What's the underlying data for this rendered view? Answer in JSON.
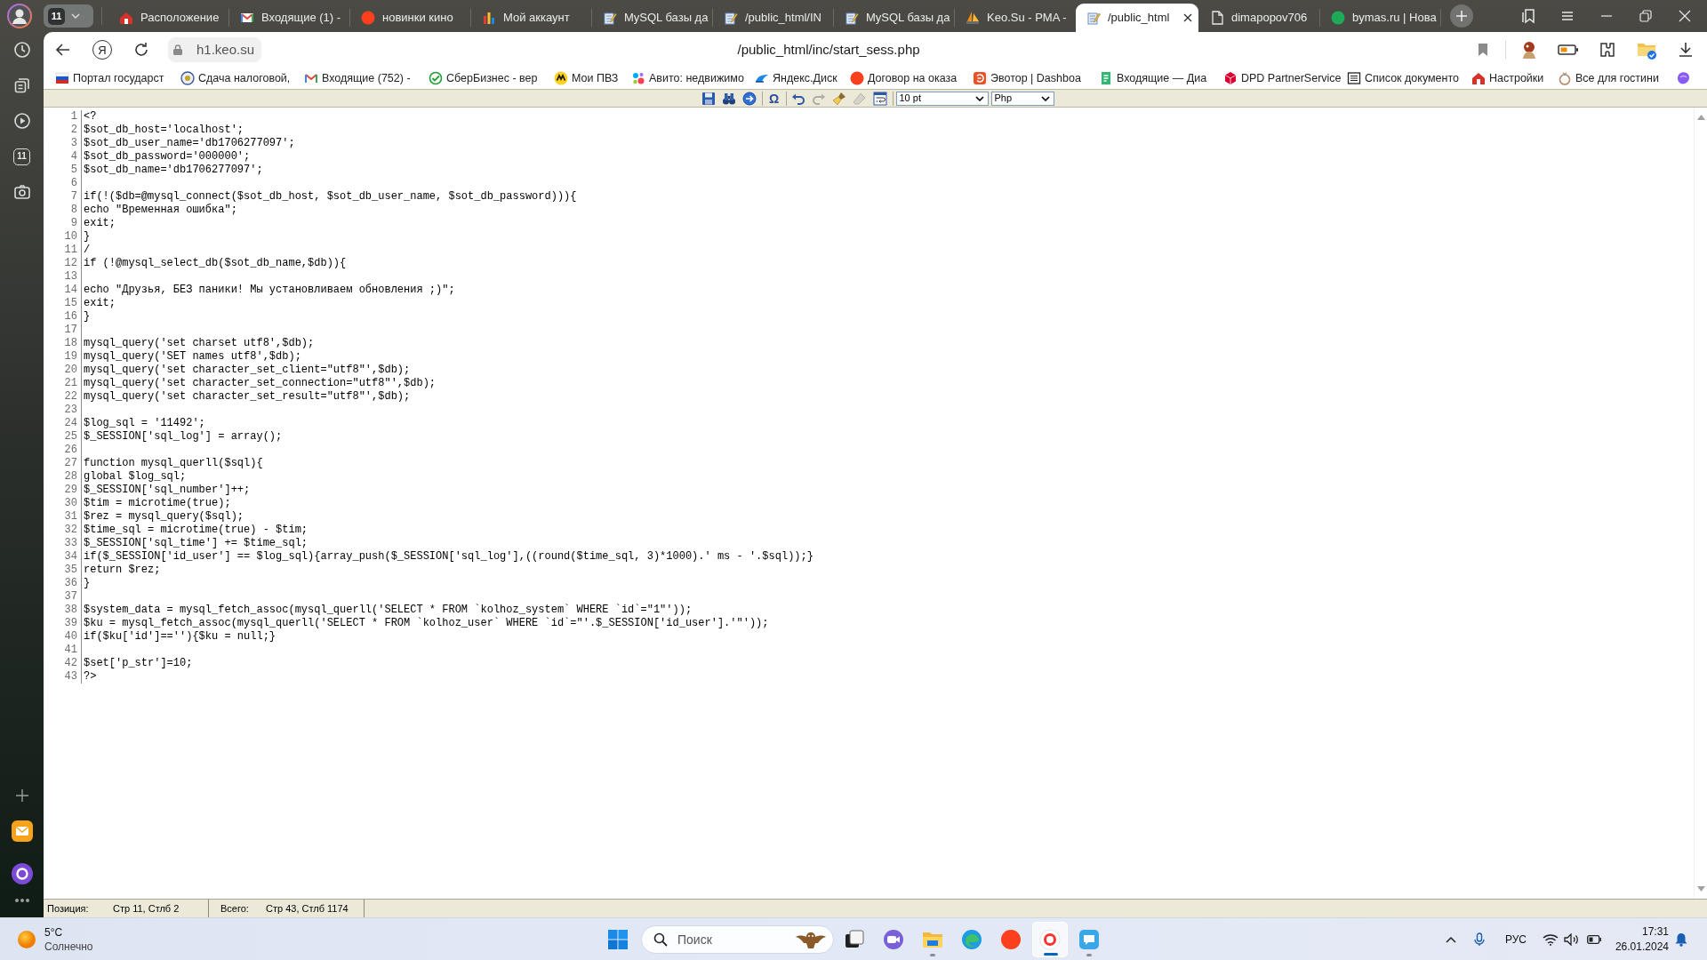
{
  "browser": {
    "tab_count": "11",
    "tabs": [
      {
        "title": "Расположение",
        "selected": false
      },
      {
        "title": "Входящие (1) -",
        "selected": false
      },
      {
        "title": "новинки кино",
        "selected": false
      },
      {
        "title": "Мой аккаунт",
        "selected": false
      },
      {
        "title": "MySQL базы да",
        "selected": false
      },
      {
        "title": "/public_html/IN",
        "selected": false
      },
      {
        "title": "MySQL базы да",
        "selected": false
      },
      {
        "title": "Keo.Su - PMA -",
        "selected": false
      },
      {
        "title": "/public_html",
        "selected": true
      },
      {
        "title": "dimapopov706",
        "selected": false
      },
      {
        "title": "bymas.ru | Нова",
        "selected": false
      }
    ],
    "home_label": "Я",
    "address": "h1.keo.su",
    "page_title": "/public_html/inc/start_sess.php",
    "bookmarks": [
      "Портал государст",
      "Сдача налоговой,",
      "Входящие (752) -",
      "СберБизнес - вер",
      "Мои ПВЗ",
      "Авито: недвижимо",
      "Яндекс.Диск",
      "Договор на оказа",
      "Эвотор | Dashboa",
      "Входящие — Диа",
      "DPD PartnerService",
      "Список документо",
      "Настройки",
      "Все для гостини"
    ]
  },
  "sidebar": {
    "tab_count": "11"
  },
  "editor": {
    "toolbar": {
      "buttons": [
        {
          "disabled": false
        },
        {
          "disabled": false
        },
        {
          "disabled": false
        },
        {
          "label": "Ω",
          "disabled": false
        },
        {
          "disabled": false
        },
        {
          "disabled": true
        },
        {
          "disabled": false
        },
        {
          "disabled": true
        },
        {
          "disabled": false
        }
      ],
      "font_size": "10 pt",
      "language": "Php"
    },
    "lines": [
      {
        "number": "1",
        "text": "<?"
      },
      {
        "number": "2",
        "text": "$sot_db_host='localhost';"
      },
      {
        "number": "3",
        "text": "$sot_db_user_name='db1706277097';"
      },
      {
        "number": "4",
        "text": "$sot_db_password='000000';"
      },
      {
        "number": "5",
        "text": "$sot_db_name='db1706277097';"
      },
      {
        "number": "6"
      },
      {
        "number": "7",
        "text": "if(!($db=@mysql_connect($sot_db_host, $sot_db_user_name, $sot_db_password))){"
      },
      {
        "number": "8",
        "text": "echo \"Временная ошибка\";"
      },
      {
        "number": "9",
        "text": "exit;"
      },
      {
        "number": "10",
        "text": "}"
      },
      {
        "number": "11",
        "text": "/"
      },
      {
        "number": "12",
        "text": "if (!@mysql_select_db($sot_db_name,$db)){"
      },
      {
        "number": "13"
      },
      {
        "number": "14",
        "text": "echo \"Друзья, БЕЗ паники! Мы установливаем обновления ;)\";"
      },
      {
        "number": "15",
        "text": "exit;"
      },
      {
        "number": "16",
        "text": "}"
      },
      {
        "number": "17"
      },
      {
        "number": "18",
        "text": "mysql_query('set charset utf8',$db);"
      },
      {
        "number": "19",
        "text": "mysql_query('SET names utf8',$db);"
      },
      {
        "number": "20",
        "text": "mysql_query('set character_set_client=\"utf8\"',$db);"
      },
      {
        "number": "21",
        "text": "mysql_query('set character_set_connection=\"utf8\"',$db);"
      },
      {
        "number": "22",
        "text": "mysql_query('set character_set_result=\"utf8\"',$db);"
      },
      {
        "number": "23"
      },
      {
        "number": "24",
        "text": "$log_sql = '11492';"
      },
      {
        "number": "25",
        "text": "$_SESSION['sql_log'] = array();"
      },
      {
        "number": "26"
      },
      {
        "number": "27",
        "text": "function mysql_querll($sql){"
      },
      {
        "number": "28",
        "text": "global $log_sql;"
      },
      {
        "number": "29",
        "text": "$_SESSION['sql_number']++;"
      },
      {
        "number": "30",
        "text": "$tim = microtime(true);"
      },
      {
        "number": "31",
        "text": "$rez = mysql_query($sql);"
      },
      {
        "number": "32",
        "text": "$time_sql = microtime(true) - $tim;"
      },
      {
        "number": "33",
        "text": "$_SESSION['sql_time'] += $time_sql;"
      },
      {
        "number": "34",
        "text": "if($_SESSION['id_user'] == $log_sql){array_push($_SESSION['sql_log'],((round($time_sql, 3)*1000).' ms - '.$sql));}"
      },
      {
        "number": "35",
        "text": "return $rez;"
      },
      {
        "number": "36",
        "text": "}"
      },
      {
        "number": "37"
      },
      {
        "number": "38",
        "text": "$system_data = mysql_fetch_assoc(mysql_querll('SELECT * FROM `kolhoz_system` WHERE `id`=\"1\"'));"
      },
      {
        "number": "39",
        "text": "$ku = mysql_fetch_assoc(mysql_querll('SELECT * FROM `kolhoz_user` WHERE `id`=\"'.$_SESSION['id_user'].'\"'));"
      },
      {
        "number": "40",
        "text": "if($ku['id']==''){$ku = null;}"
      },
      {
        "number": "41"
      },
      {
        "number": "42",
        "text": "$set['p_str']=10;"
      },
      {
        "number": "43",
        "text": "?>"
      }
    ],
    "status": {
      "position_label": "Позиция:",
      "position": "Стр 11, Стлб 2",
      "total_label": "Всего:",
      "total": "Стр 43, Стлб 1174"
    }
  },
  "taskbar": {
    "weather": {
      "temperature": "5°C",
      "condition": "Солнечно"
    },
    "search_placeholder": "Поиск",
    "apps": [
      {
        "running": false,
        "selected": false
      },
      {
        "running": false,
        "selected": false
      },
      {
        "running": true,
        "selected": false
      },
      {
        "running": false,
        "selected": false
      },
      {
        "running": false,
        "selected": false
      },
      {
        "running": true,
        "selected": true
      },
      {
        "running": true,
        "selected": false
      }
    ],
    "language": "РУС",
    "time": "17:31",
    "date": "26.01.2024"
  }
}
